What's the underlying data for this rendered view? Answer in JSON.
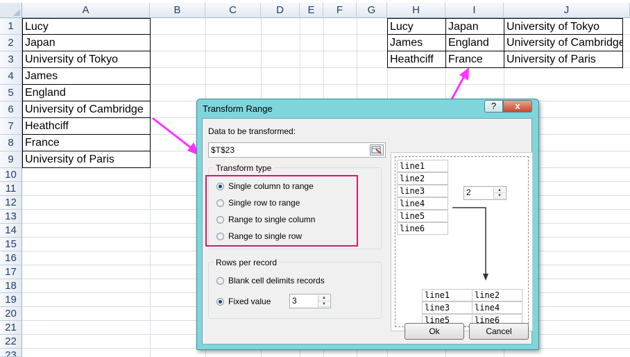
{
  "sheet": {
    "columns": [
      "A",
      "B",
      "C",
      "D",
      "E",
      "F",
      "G",
      "H",
      "I",
      "J"
    ],
    "rows": [
      "1",
      "2",
      "3",
      "4",
      "5",
      "6",
      "7",
      "8",
      "9",
      "10",
      "11",
      "12",
      "13",
      "14",
      "15",
      "16",
      "17",
      "18",
      "19",
      "20",
      "21",
      "22",
      "23"
    ],
    "colA": [
      "Lucy",
      "Japan",
      "University of Tokyo",
      "James",
      "England",
      "University of Cambridge",
      "Heathciff",
      "France",
      "University of Paris"
    ],
    "result": [
      [
        "Lucy",
        "Japan",
        "University of Tokyo"
      ],
      [
        "James",
        "England",
        "University of Cambridge"
      ],
      [
        "Heathciff",
        "France",
        "University of Paris"
      ]
    ]
  },
  "dialog": {
    "title": "Transform Range",
    "help_label": "?",
    "close_label": "x",
    "data_label": "Data to be transformed:",
    "range_value": "$T$23",
    "transform_type_label": "Transform type",
    "transform_options": [
      "Single column to range",
      "Single row to range",
      "Range to single column",
      "Range to single row"
    ],
    "selected_transform": 0,
    "rows_per_record_label": "Rows per record",
    "record_options": [
      "Blank cell delimits records",
      "Fixed value"
    ],
    "selected_record": 1,
    "fixed_value": "3",
    "ok_label": "Ok",
    "cancel_label": "Cancel",
    "preview": {
      "source": [
        "line1",
        "line2",
        "line3",
        "line4",
        "line5",
        "line6"
      ],
      "spinner_value": "2",
      "result": [
        [
          "line1",
          "line2"
        ],
        [
          "line3",
          "line4"
        ],
        [
          "line5",
          "line6"
        ]
      ]
    }
  },
  "colors": {
    "arrow": "#ff33ff",
    "highlight_box": "#d4186f",
    "title_bar": "#7ed6dc"
  }
}
